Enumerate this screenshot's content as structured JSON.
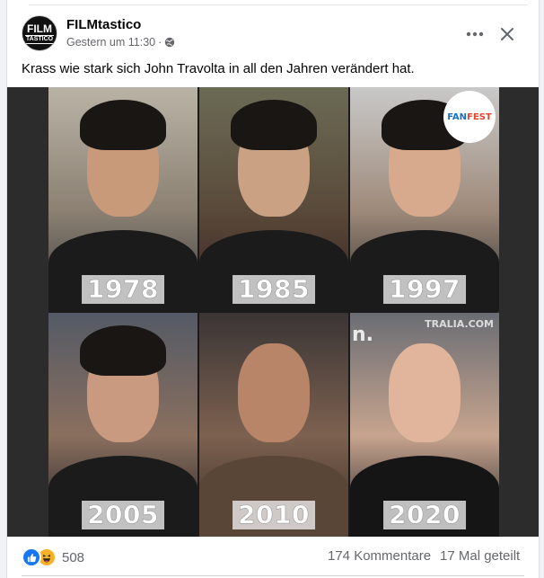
{
  "post": {
    "page_name": "FILMtastico",
    "avatar_text_top": "FILM",
    "avatar_text_bottom": "TASTICO",
    "timestamp": "Gestern um 11:30",
    "separator": "·",
    "privacy_icon": "globe-icon",
    "caption": "Krass wie stark sich John Travolta in all den Jahren verändert hat."
  },
  "header_actions": {
    "more_icon": "more-horizontal-icon",
    "close_icon": "close-icon"
  },
  "photo": {
    "panels": [
      {
        "year": "1978"
      },
      {
        "year": "1985"
      },
      {
        "year": "1997"
      },
      {
        "year": "2005"
      },
      {
        "year": "2010"
      },
      {
        "year": "2020"
      }
    ],
    "badge_fan": "FAN",
    "badge_fest": "FEST",
    "watermark_right": "TRALIA.COM",
    "watermark_left": "n."
  },
  "footer": {
    "reaction_icons": [
      "like-icon",
      "haha-icon"
    ],
    "reaction_count": "508",
    "comments": "174 Kommentare",
    "shares": "17 Mal geteilt"
  },
  "colors": {
    "like": "#1877f2",
    "haha": "#f7b125",
    "secondary_text": "#65676b"
  }
}
